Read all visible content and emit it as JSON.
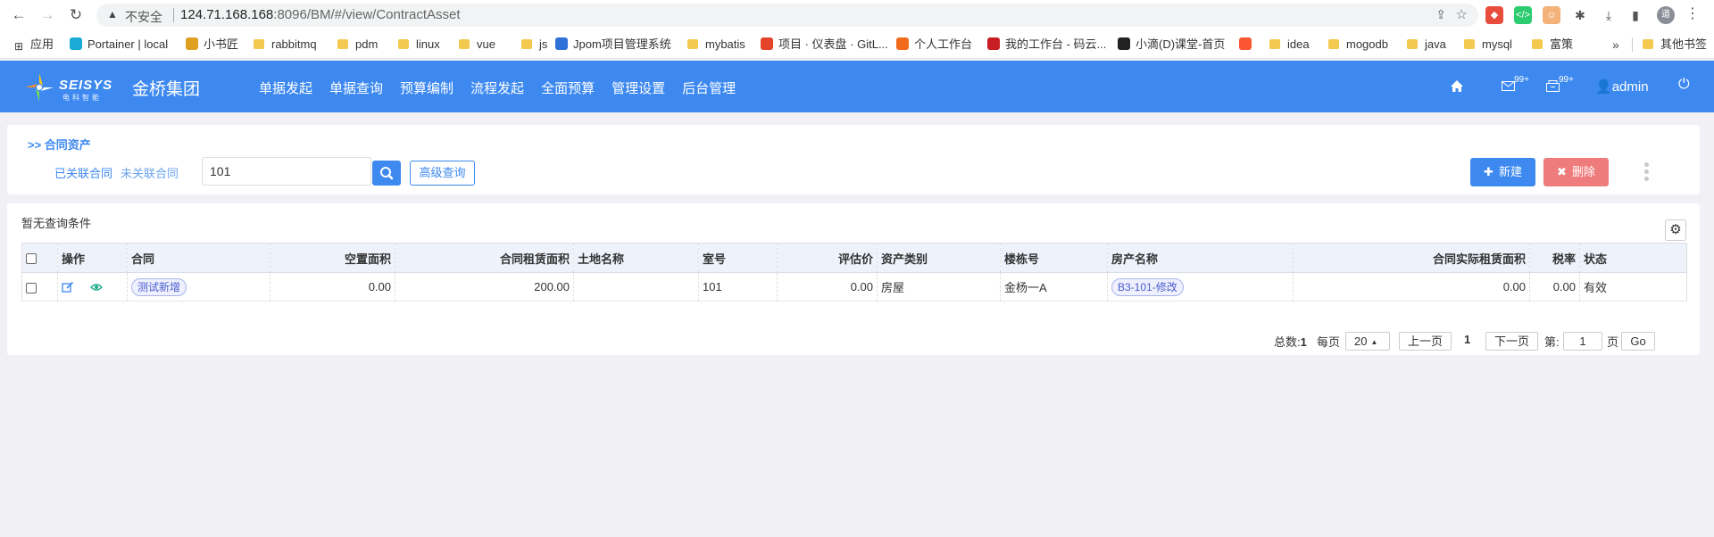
{
  "browser": {
    "insecure_label": "不安全",
    "url_host": "124.71.168.168",
    "url_rest": ":8096/BM/#/view/ContractAsset",
    "profile_initial": "道",
    "bookmarks": [
      {
        "label": "应用",
        "kind": "grid"
      },
      {
        "label": "Portainer | local",
        "kind": "site",
        "color": "#1ba9d6"
      },
      {
        "label": "小书匠",
        "kind": "site",
        "color": "#e0a020"
      },
      {
        "label": "rabbitmq",
        "kind": "folder"
      },
      {
        "label": "pdm",
        "kind": "folder"
      },
      {
        "label": "linux",
        "kind": "folder"
      },
      {
        "label": "vue",
        "kind": "folder"
      },
      {
        "label": "js",
        "kind": "folder"
      },
      {
        "label": "Jpom项目管理系统",
        "kind": "site",
        "color": "#2e6fd8"
      },
      {
        "label": "mybatis",
        "kind": "folder"
      },
      {
        "label": "项目 · 仪表盘 · GitL...",
        "kind": "site",
        "color": "#e24329"
      },
      {
        "label": "个人工作台",
        "kind": "site",
        "color": "#f26b1d"
      },
      {
        "label": "我的工作台 - 码云...",
        "kind": "site",
        "color": "#c71d23"
      },
      {
        "label": "小滴(D)课堂-首页",
        "kind": "site",
        "color": "#222222"
      },
      {
        "label": "",
        "kind": "site",
        "color": "#fc5531"
      },
      {
        "label": "idea",
        "kind": "folder"
      },
      {
        "label": "mogodb",
        "kind": "folder"
      },
      {
        "label": "java",
        "kind": "folder"
      },
      {
        "label": "mysql",
        "kind": "folder"
      },
      {
        "label": "富策",
        "kind": "folder"
      }
    ],
    "more": "»",
    "other_bookmarks": "其他书签"
  },
  "header": {
    "logo_text": "SEISYS",
    "logo_sub": "电科智能",
    "company": "金桥集团",
    "nav": [
      "单据发起",
      "单据查询",
      "预算编制",
      "流程发起",
      "全面预算",
      "管理设置",
      "后台管理"
    ],
    "mail_badge": "99+",
    "msg_badge": "99+",
    "user": "admin"
  },
  "filter": {
    "breadcrumb": ">> 合同资产",
    "tab_linked": "已关联合同",
    "tab_unlinked": "未关联合同",
    "search_value": "101",
    "advanced_label": "高级查询",
    "new_label": "新建",
    "delete_label": "删除"
  },
  "table": {
    "no_condition": "暂无查询条件",
    "columns": [
      "操作",
      "合同",
      "空置面积",
      "合同租赁面积",
      "土地名称",
      "室号",
      "评估价",
      "资产类别",
      "楼栋号",
      "房产名称",
      "合同实际租赁面积",
      "税率",
      "状态"
    ],
    "rows": [
      {
        "contract": "测试新增",
        "vacant_area": "0.00",
        "lease_area": "200.00",
        "land_name": "",
        "room": "101",
        "valuation": "0.00",
        "asset_type": "房屋",
        "building": "金杨一A",
        "property": "B3-101-修改",
        "actual_area": "0.00",
        "tax_rate": "0.00",
        "status": "有效"
      }
    ]
  },
  "pagination": {
    "total_label": "总数:",
    "total": "1",
    "per_page_label": "每页",
    "per_page": "20",
    "prev": "上一页",
    "current": "1",
    "next": "下一页",
    "goto_label": "第:",
    "goto_value": "1",
    "page_suffix": "页",
    "go": "Go"
  }
}
